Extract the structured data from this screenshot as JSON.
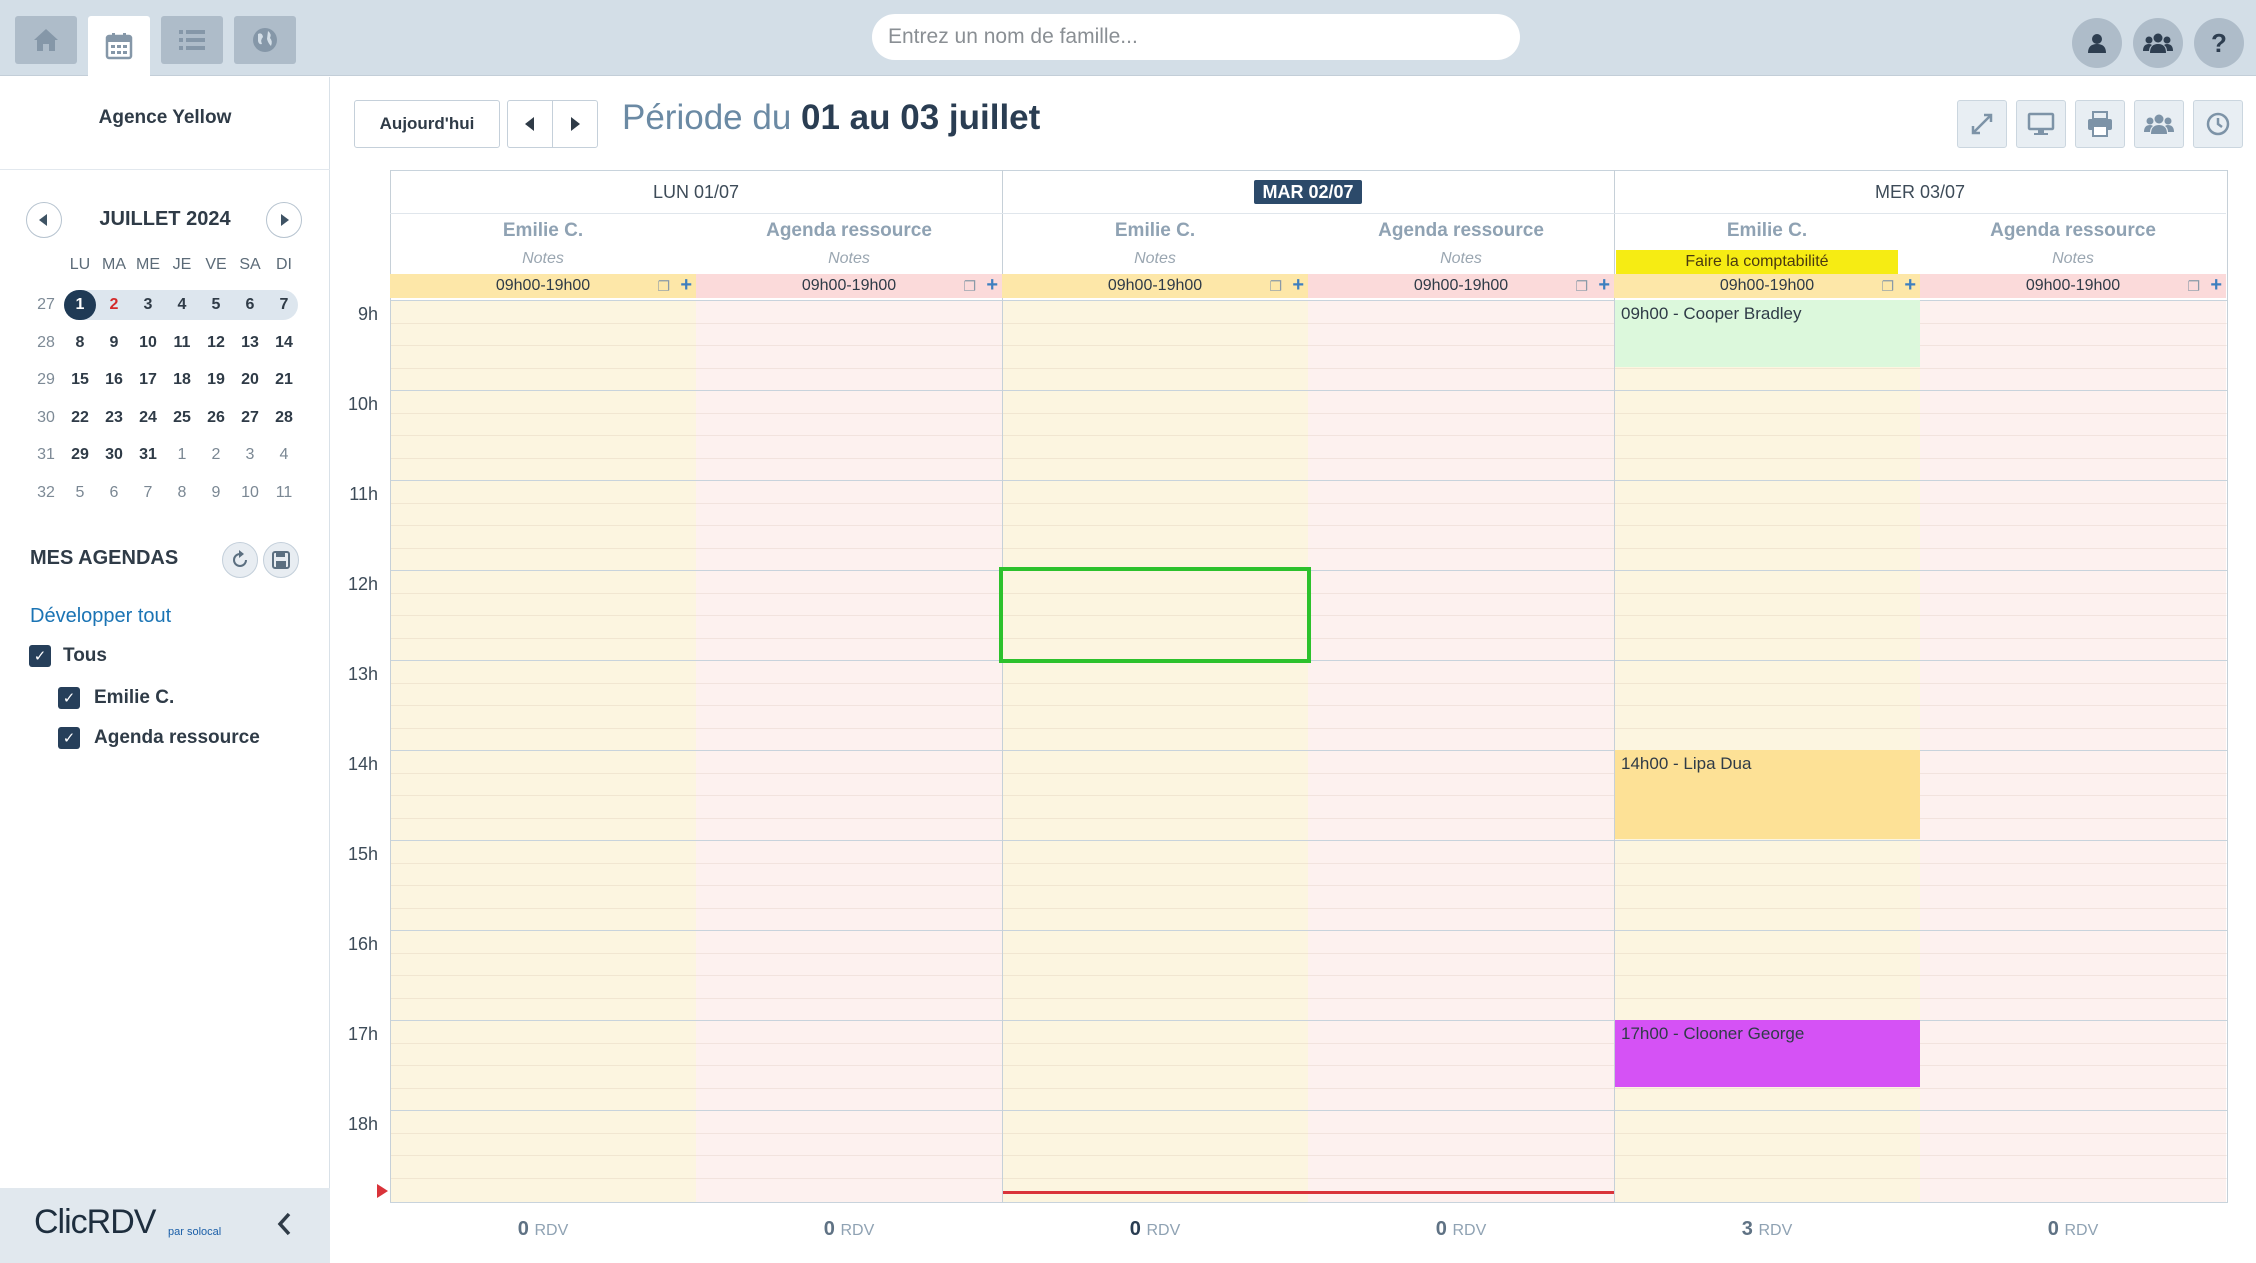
{
  "topbar": {
    "search_placeholder": "Entrez un nom de famille...",
    "nav_icons": [
      "home-icon",
      "calendar-icon",
      "list-icon",
      "globe-icon"
    ],
    "right_icons": [
      "user-icon",
      "group-icon",
      "help-icon"
    ],
    "help_label": "?"
  },
  "sidebar": {
    "agency": "Agence Yellow",
    "calendar": {
      "month": "JUILLET 2024",
      "weekdays": [
        "LU",
        "MA",
        "ME",
        "JE",
        "VE",
        "SA",
        "DI"
      ],
      "weeks": [
        {
          "num": "27",
          "days": [
            "1",
            "2",
            "3",
            "4",
            "5",
            "6",
            "7"
          ]
        },
        {
          "num": "28",
          "days": [
            "8",
            "9",
            "10",
            "11",
            "12",
            "13",
            "14"
          ]
        },
        {
          "num": "29",
          "days": [
            "15",
            "16",
            "17",
            "18",
            "19",
            "20",
            "21"
          ]
        },
        {
          "num": "30",
          "days": [
            "22",
            "23",
            "24",
            "25",
            "26",
            "27",
            "28"
          ]
        },
        {
          "num": "31",
          "days": [
            "29",
            "30",
            "31",
            "1",
            "2",
            "3",
            "4"
          ]
        },
        {
          "num": "32",
          "days": [
            "5",
            "6",
            "7",
            "8",
            "9",
            "10",
            "11"
          ]
        }
      ],
      "today": "1",
      "highlight_red": "2"
    },
    "agendas_title": "MES AGENDAS",
    "expand_all": "Développer tout",
    "checkboxes": [
      {
        "label": "Tous",
        "checked": true
      },
      {
        "label": "Emilie C.",
        "checked": true
      },
      {
        "label": "Agenda ressource",
        "checked": true
      }
    ],
    "logo": "ClicRDV",
    "logo_sub": "par solocal"
  },
  "header": {
    "today_button": "Aujourd'hui",
    "period_prefix": "Période du",
    "period_range": "01 au 03 juillet",
    "tool_icons": [
      "expand-icon",
      "monitor-icon",
      "print-icon",
      "group-icon",
      "history-icon"
    ]
  },
  "calendar": {
    "hours": [
      "9h",
      "10h",
      "11h",
      "12h",
      "13h",
      "14h",
      "15h",
      "16h",
      "17h",
      "18h"
    ],
    "days": [
      {
        "label": "LUN 01/07",
        "current": false
      },
      {
        "label": "MAR 02/07",
        "current": true
      },
      {
        "label": "MER 03/07",
        "current": false
      }
    ],
    "columns": [
      {
        "name": "Emilie C.",
        "notes": "Notes",
        "hours": "09h00-19h00",
        "total": "0",
        "unit": "RDV",
        "color": "#fcf5e0"
      },
      {
        "name": "Agenda ressource",
        "notes": "Notes",
        "hours": "09h00-19h00",
        "total": "0",
        "unit": "RDV",
        "color": "#fdf1ef"
      },
      {
        "name": "Emilie C.",
        "notes": "Notes",
        "hours": "09h00-19h00",
        "total": "0",
        "unit": "RDV",
        "color": "#fcf5e0"
      },
      {
        "name": "Agenda ressource",
        "notes": "Notes",
        "hours": "09h00-19h00",
        "total": "0",
        "unit": "RDV",
        "color": "#fdf1ef"
      },
      {
        "name": "Emilie C.",
        "notes": "Faire la comptabilité",
        "hours": "09h00-19h00",
        "total": "3",
        "unit": "RDV",
        "color": "#fcf5e0"
      },
      {
        "name": "Agenda ressource",
        "notes": "Notes",
        "hours": "09h00-19h00",
        "total": "0",
        "unit": "RDV",
        "color": "#fdf1ef"
      }
    ],
    "events": [
      {
        "label": "09h00 - Cooper Bradley",
        "color": "#dcf8dc"
      },
      {
        "label": "14h00 - Lipa Dua",
        "color": "#fde196"
      },
      {
        "label": "17h00 - Clooner George",
        "color": "#d552f5"
      }
    ]
  }
}
